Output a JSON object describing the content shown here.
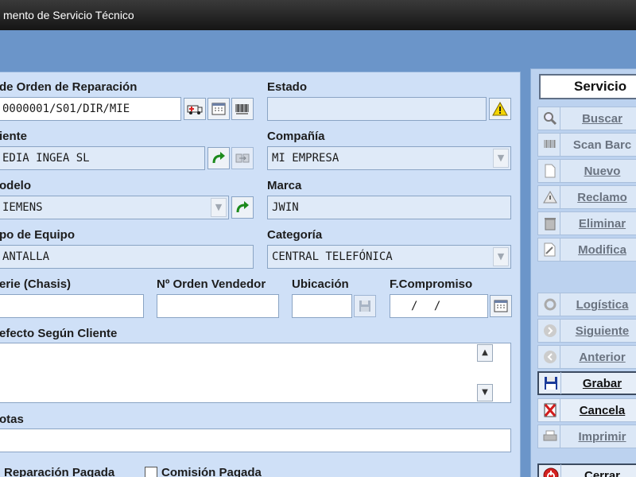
{
  "window": {
    "title": "mento de Servicio Técnico"
  },
  "form": {
    "orden": {
      "label": "de Orden de Reparación",
      "value": "0000001/S01/DIR/MIE"
    },
    "estado": {
      "label": "Estado",
      "value": ""
    },
    "cliente": {
      "label": "iente",
      "value": "EDIA INGEA SL"
    },
    "compania": {
      "label": "Compañía",
      "value": "MI EMPRESA"
    },
    "modelo": {
      "label": "odelo",
      "value": "IEMENS"
    },
    "marca": {
      "label": "Marca",
      "value": "JWIN"
    },
    "tipo_equipo": {
      "label": "po de Equipo",
      "value": "ANTALLA"
    },
    "categoria": {
      "label": "Categoría",
      "value": "CENTRAL TELEFÓNICA"
    },
    "serie": {
      "label": "erie (Chasis)",
      "value": ""
    },
    "orden_vendedor": {
      "label": "Nº Orden Vendedor",
      "value": ""
    },
    "ubicacion": {
      "label": "Ubicación",
      "value": ""
    },
    "f_compromiso": {
      "label": "F.Compromiso",
      "value": "/ /"
    },
    "defecto": {
      "label": "efecto Según Cliente",
      "value": ""
    },
    "notas": {
      "label": "otas",
      "value": ""
    },
    "reparacion_pagada": {
      "label": "Reparación Pagada",
      "checked": false
    },
    "comision_pagada": {
      "label": "Comisión Pagada",
      "checked": false
    }
  },
  "sidebar": {
    "header": "Servicio",
    "buttons": {
      "buscar": "Buscar",
      "scan": "Scan Barc",
      "nuevo": "Nuevo",
      "reclamo": "Reclamo",
      "eliminar": "Eliminar",
      "modificar": "Modifica",
      "logistica": "Logística",
      "siguiente": "Siguiente",
      "anterior": "Anterior",
      "grabar": "Grabar",
      "cancelar": "Cancela",
      "imprimir": "Imprimir",
      "cerrar": "Cerrar"
    }
  },
  "icons": {
    "ambulance": "ambulance-icon",
    "calendar": "calendar-icon",
    "barcode": "barcode-icon",
    "warning": "warning-icon",
    "refresh": "refresh-arrow-icon",
    "transfer": "transfer-icon",
    "save": "floppy-disk-icon"
  }
}
